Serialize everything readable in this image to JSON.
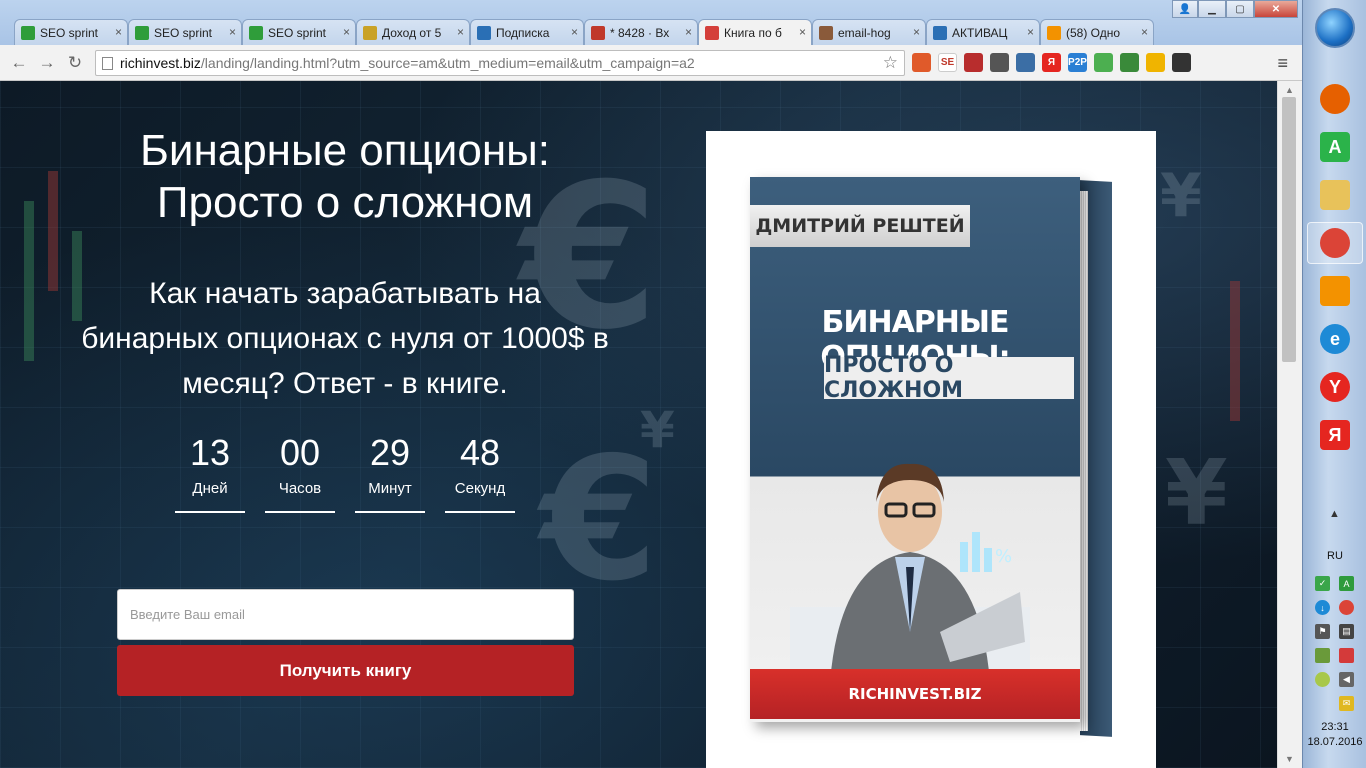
{
  "browser": {
    "tabs": [
      {
        "label": "SEO sprint",
        "icon": "seosprint-icon",
        "color": "#2f9d3a"
      },
      {
        "label": "SEO sprint",
        "icon": "seosprint-icon",
        "color": "#2f9d3a"
      },
      {
        "label": "SEO sprint",
        "icon": "seosprint-icon",
        "color": "#2f9d3a"
      },
      {
        "label": "Доход от 5",
        "icon": "money-icon",
        "color": "#c9a227"
      },
      {
        "label": "Подписка",
        "icon": "sr-icon",
        "color": "#2a6fb5"
      },
      {
        "label": "* 8428 · Вх",
        "icon": "mail-icon",
        "color": "#c0392b"
      },
      {
        "label": "Книга по б",
        "icon": "flag-icon",
        "color": "#d43f3a"
      },
      {
        "label": "email-hog",
        "icon": "hog-icon",
        "color": "#8a5a3a"
      },
      {
        "label": "АКТИВАЦ",
        "icon": "sr-icon",
        "color": "#2a6fb5"
      },
      {
        "label": "(58) Одно",
        "icon": "ok-icon",
        "color": "#f39200"
      }
    ],
    "active_tab": 6,
    "url_host": "richinvest.biz",
    "url_path": "/landing/landing.html?utm_source=am&utm_medium=email&utm_campaign=a2",
    "extensions": [
      {
        "name": "extension-1-icon",
        "text": "",
        "color": "#e05a2a"
      },
      {
        "name": "se-extension-icon",
        "text": "SE",
        "color": "#ffffff"
      },
      {
        "name": "lock-extension-icon",
        "text": "",
        "color": "#b82d2d"
      },
      {
        "name": "box-extension-icon",
        "text": "",
        "color": "#555555"
      },
      {
        "name": "screen-extension-icon",
        "text": "",
        "color": "#3b6ea5"
      },
      {
        "name": "yandex-extension-icon",
        "text": "Я",
        "color": "#e52620"
      },
      {
        "name": "p2p-extension-icon",
        "text": "P2P",
        "color": "#2a7fd4"
      },
      {
        "name": "sprout-extension-icon",
        "text": "",
        "color": "#4caf50"
      },
      {
        "name": "sync-extension-icon",
        "text": "",
        "color": "#3a8a3a"
      },
      {
        "name": "bookmark-extension-icon",
        "text": "",
        "color": "#f0b400"
      },
      {
        "name": "paw-extension-icon",
        "text": "",
        "color": "#333333"
      }
    ]
  },
  "landing": {
    "headline_line1": "Бинарные опционы:",
    "headline_line2": "Просто о сложном",
    "subheadline": "Как начать зарабатывать на бинарных опционах с нуля от 1000$ в месяц? Ответ - в книге.",
    "countdown": [
      {
        "value": "13",
        "label": "Дней"
      },
      {
        "value": "00",
        "label": "Часов"
      },
      {
        "value": "29",
        "label": "Минут"
      },
      {
        "value": "48",
        "label": "Секунд"
      }
    ],
    "email_placeholder": "Введите Ваш email",
    "button_label": "Получить книгу",
    "accent": "#b52225"
  },
  "book": {
    "author": "ДМИТРИЙ РЕШТЕЙ",
    "title": "БИНАРНЫЕ ОПЦИОНЫ:",
    "subtitle": "ПРОСТО О СЛОЖНОМ",
    "site": "RICHINVEST.BIZ"
  },
  "taskbar": {
    "pinned": [
      {
        "name": "firefox-icon",
        "text": "",
        "color": "#e66000"
      },
      {
        "name": "apteka-icon",
        "text": "A",
        "color": "#2bb34a"
      },
      {
        "name": "folder-icon",
        "text": "",
        "color": "#e8c25a"
      },
      {
        "name": "chrome-icon",
        "text": "",
        "color": "#db4437"
      },
      {
        "name": "odnoklassniki-icon",
        "text": "",
        "color": "#f39200"
      },
      {
        "name": "ie-icon",
        "text": "e",
        "color": "#1e8ad6"
      },
      {
        "name": "yandex-browser-icon",
        "text": "Y",
        "color": "#e52620"
      },
      {
        "name": "yandex-icon",
        "text": "Я",
        "color": "#e52620"
      }
    ],
    "language": "RU",
    "time": "23:31",
    "date": "18.07.2016"
  }
}
